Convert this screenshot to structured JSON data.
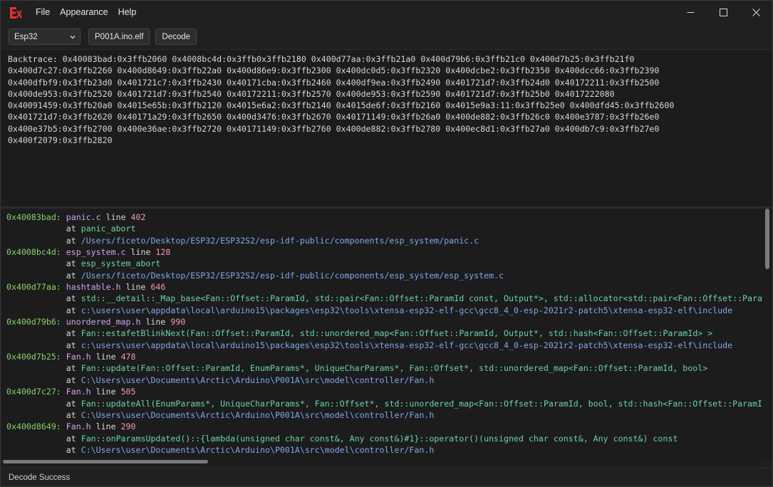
{
  "titlebar": {
    "menu": [
      "File",
      "Appearance",
      "Help"
    ]
  },
  "toolbar": {
    "board_value": "Esp32",
    "elf_button_label": "P001A.ino.elf",
    "decode_button_label": "Decode"
  },
  "backtrace_lines": [
    "Backtrace: 0x40083bad:0x3ffb2060 0x4008bc4d:0x3ffb0x3ffb2180 0x400d77aa:0x3ffb21a0 0x400d79b6:0x3ffb21c0 0x400d7b25:0x3ffb21f0",
    "0x400d7c27:0x3ffb2260 0x400d8649:0x3ffb22a0 0x400d86e9:0x3ffb2300 0x400dc0d5:0x3ffb2320 0x400dcbe2:0x3ffb2350 0x400dcc66:0x3ffb2390",
    "0x400dfbf9:0x3ffb23d0 0x401721c7:0x3ffb2430 0x40171cba:0x3ffb2460 0x400df9ea:0x3ffb2490 0x401721d7:0x3ffb24d0 0x40172211:0x3ffb2500",
    "0x400de953:0x3ffb2520 0x401721d7:0x3ffb2540 0x40172211:0x3ffb2570 0x400de953:0x3ffb2590 0x401721d7:0x3ffb25b0 0x4017222080",
    "0x40091459:0x3ffb20a0 0x4015e65b:0x3ffb2120 0x4015e6a2:0x3ffb2140 0x4015de6f:0x3ffb2160 0x4015e9a3:11:0x3ffb25e0 0x400dfd45:0x3ffb2600",
    "0x401721d7:0x3ffb2620 0x40171a29:0x3ffb2650 0x400d3476:0x3ffb2670 0x40171149:0x3ffb26a0 0x400de882:0x3ffb26c0 0x400e3787:0x3ffb26e0",
    "0x400e37b5:0x3ffb2700 0x400e36ae:0x3ffb2720 0x40171149:0x3ffb2760 0x400de882:0x3ffb2780 0x400ec8d1:0x3ffb27a0 0x400db7c9:0x3ffb27e0",
    "0x400f2079:0x3ffb2820"
  ],
  "decoded": {
    "at_label": "at",
    "line_label": "line",
    "entries": [
      {
        "address": "0x40083bad:",
        "file": "panic.c",
        "line": "402",
        "function": "panic_abort",
        "path": "/Users/ficeto/Desktop/ESP32/ESP32S2/esp-idf-public/components/esp_system/panic.c"
      },
      {
        "address": "0x4008bc4d:",
        "file": "esp_system.c",
        "line": "128",
        "function": "esp_system_abort",
        "path": "/Users/ficeto/Desktop/ESP32/ESP32S2/esp-idf-public/components/esp_system/esp_system.c"
      },
      {
        "address": "0x400d77aa:",
        "file": "hashtable.h",
        "line": "646",
        "function": "std::__detail::_Map_base<Fan::Offset::ParamId, std::pair<Fan::Offset::ParamId const, Output*>, std::allocator<std::pair<Fan::Offset::ParamId const, Output*> >",
        "path": "c:\\users\\user\\appdata\\local\\arduino15\\packages\\esp32\\tools\\xtensa-esp32-elf-gcc\\gcc8_4_0-esp-2021r2-patch5\\xtensa-esp32-elf\\include"
      },
      {
        "address": "0x400d79b6:",
        "file": "unordered_map.h",
        "line": "990",
        "function": "Fan::estafetBlinkNext(Fan::Offset::ParamId, std::unordered_map<Fan::Offset::ParamId, Output*, std::hash<Fan::Offset::ParamId> >",
        "path": "c:\\users\\user\\appdata\\local\\arduino15\\packages\\esp32\\tools\\xtensa-esp32-elf-gcc\\gcc8_4_0-esp-2021r2-patch5\\xtensa-esp32-elf\\include"
      },
      {
        "address": "0x400d7b25:",
        "file": "Fan.h",
        "line": "478",
        "function": "Fan::update(Fan::Offset::ParamId, EnumParams*, UniqueCharParams*, Fan::Offset*, std::unordered_map<Fan::Offset::ParamId, bool>",
        "path": "C:\\Users\\user\\Documents\\Arctic\\Arduino\\P001A\\src\\model\\controller/Fan.h"
      },
      {
        "address": "0x400d7c27:",
        "file": "Fan.h",
        "line": "505",
        "function": "Fan::updateAll(EnumParams*, UniqueCharParams*, Fan::Offset*, std::unordered_map<Fan::Offset::ParamId, bool, std::hash<Fan::Offset::ParamId> >",
        "path": "C:\\Users\\user\\Documents\\Arctic\\Arduino\\P001A\\src\\model\\controller/Fan.h"
      },
      {
        "address": "0x400d8649:",
        "file": "Fan.h",
        "line": "290",
        "function": "Fan::onParamsUpdated()::{lambda(unsigned char const&, Any const&)#1}::operator()(unsigned char const&, Any const&) const",
        "path": "C:\\Users\\user\\Documents\\Arctic\\Arduino\\P001A\\src\\model\\controller/Fan.h"
      }
    ]
  },
  "status": {
    "text": "Decode Success"
  },
  "colors": {
    "address": "#8ad26b",
    "file": "#cfa4f0",
    "line_number": "#f09ab6",
    "function": "#6ad1a5",
    "path": "#7fa7ea",
    "logo": "#e8322b"
  },
  "icons": {
    "logo": "app-logo-icon",
    "minimize": "minimize-icon",
    "maximize": "maximize-icon",
    "close": "close-icon",
    "dropdown": "chevron-down-icon"
  }
}
